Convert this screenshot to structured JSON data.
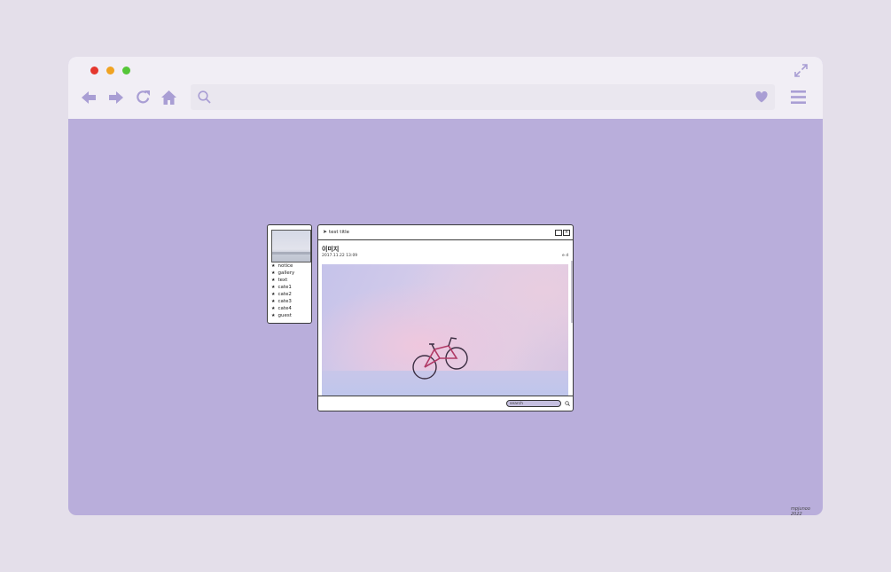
{
  "browser": {
    "window_controls": [
      "close",
      "minimize",
      "maximize"
    ],
    "nav_icons": [
      "back-icon",
      "forward-icon",
      "reload-icon",
      "home-icon"
    ],
    "address_bar": {
      "value": "",
      "icon": "search-icon",
      "bookmark_icon": "heart-icon"
    },
    "menu_icon": "hamburger-menu-icon",
    "expand_icon": "expand-icon",
    "accent_color": "#9d8fd1",
    "background_color": "#b9aedb"
  },
  "sidebar": {
    "thumbnail": "landscape-thumbnail",
    "items": [
      {
        "label": "notice"
      },
      {
        "label": "gallery"
      },
      {
        "label": "text"
      },
      {
        "label": "cate1"
      },
      {
        "label": "cate2"
      },
      {
        "label": "cate3"
      },
      {
        "label": "cate4"
      },
      {
        "label": "guest"
      }
    ]
  },
  "window": {
    "title": "test title",
    "post": {
      "title": "이미지",
      "date": "2017.11.22 13:09",
      "edit_label": "e d",
      "image": "pink-bicycle-photo"
    },
    "search": {
      "placeholder": "search"
    }
  },
  "footer": {
    "credit": "mpjunoo 2022"
  }
}
